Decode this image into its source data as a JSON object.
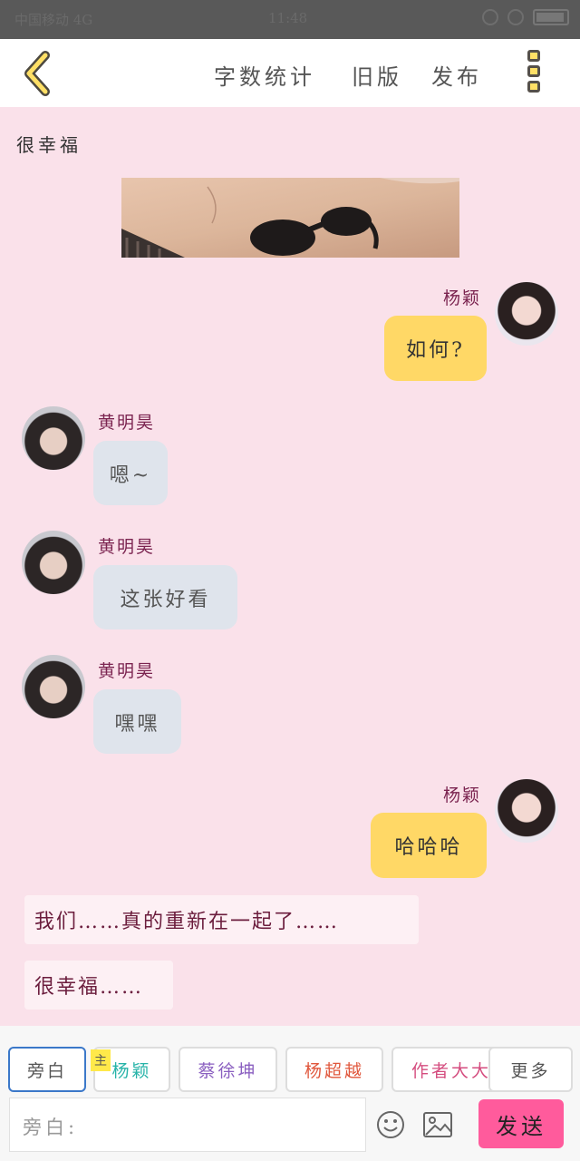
{
  "status_bar": {
    "left_text": "中国移动 4G",
    "center_text": "11:48"
  },
  "top_bar": {
    "links": [
      "字数统计",
      "旧版",
      "发布"
    ]
  },
  "messages": {
    "narration_top": "很幸福",
    "msg1": {
      "sender": "杨颖",
      "text": "如何?"
    },
    "msg2": {
      "sender": "黄明昊",
      "text": "嗯~"
    },
    "msg3": {
      "sender": "黄明昊",
      "text": "这张好看"
    },
    "msg4": {
      "sender": "黄明昊",
      "text": "嘿嘿"
    },
    "msg5": {
      "sender": "杨颖",
      "text": "哈哈哈"
    },
    "narration1": "我们……真的重新在一起了……",
    "narration2": "很幸福……"
  },
  "bottom": {
    "chips": [
      {
        "label": "旁白",
        "color": "#555555"
      },
      {
        "label": "杨颖",
        "color": "#26b3a8"
      },
      {
        "label": "蔡徐坤",
        "color": "#8a5fc0"
      },
      {
        "label": "杨超越",
        "color": "#e0573c"
      },
      {
        "label": "作者大大",
        "color": "#d44d7f"
      }
    ],
    "badge": "主",
    "more_label": "更多",
    "input_placeholder": "旁白:",
    "send_label": "发送",
    "accent": "#ff5b9c"
  }
}
